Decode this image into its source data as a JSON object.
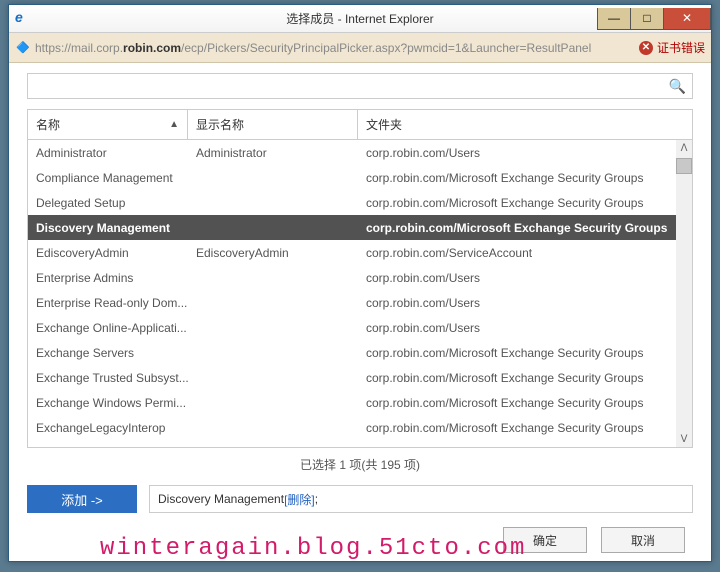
{
  "window": {
    "title": "选择成员 - Internet Explorer"
  },
  "addressbar": {
    "url_pre": "https://mail.corp.",
    "url_domain": "robin.com",
    "url_post": "/ecp/Pickers/SecurityPrincipalPicker.aspx?pwmcid=1&Launcher=ResultPanel",
    "cert_error": "证书错误"
  },
  "table": {
    "headers": {
      "name": "名称",
      "display": "显示名称",
      "folder": "文件夹"
    },
    "rows": [
      {
        "name": "Administrator",
        "display": "Administrator",
        "folder": "corp.robin.com/Users",
        "selected": false
      },
      {
        "name": "Compliance Management",
        "display": "",
        "folder": "corp.robin.com/Microsoft Exchange Security Groups",
        "selected": false
      },
      {
        "name": "Delegated Setup",
        "display": "",
        "folder": "corp.robin.com/Microsoft Exchange Security Groups",
        "selected": false
      },
      {
        "name": "Discovery Management",
        "display": "",
        "folder": "corp.robin.com/Microsoft Exchange Security Groups",
        "selected": true
      },
      {
        "name": "EdiscoveryAdmin",
        "display": "EdiscoveryAdmin",
        "folder": "corp.robin.com/ServiceAccount",
        "selected": false
      },
      {
        "name": "Enterprise Admins",
        "display": "",
        "folder": "corp.robin.com/Users",
        "selected": false
      },
      {
        "name": "Enterprise Read-only Dom...",
        "display": "",
        "folder": "corp.robin.com/Users",
        "selected": false
      },
      {
        "name": "Exchange Online-Applicati...",
        "display": "",
        "folder": "corp.robin.com/Users",
        "selected": false
      },
      {
        "name": "Exchange Servers",
        "display": "",
        "folder": "corp.robin.com/Microsoft Exchange Security Groups",
        "selected": false
      },
      {
        "name": "Exchange Trusted Subsyst...",
        "display": "",
        "folder": "corp.robin.com/Microsoft Exchange Security Groups",
        "selected": false
      },
      {
        "name": "Exchange Windows Permi...",
        "display": "",
        "folder": "corp.robin.com/Microsoft Exchange Security Groups",
        "selected": false
      },
      {
        "name": "ExchangeLegacyInterop",
        "display": "",
        "folder": "corp.robin.com/Microsoft Exchange Security Groups",
        "selected": false
      }
    ]
  },
  "status": "已选择 1 项(共 195 项)",
  "add_button": "添加 ->",
  "selected": {
    "item": "Discovery Management",
    "remove": "[删除]"
  },
  "dialog": {
    "ok": "确定",
    "cancel": "取消"
  },
  "watermark": "winteragain.blog.51cto.com"
}
